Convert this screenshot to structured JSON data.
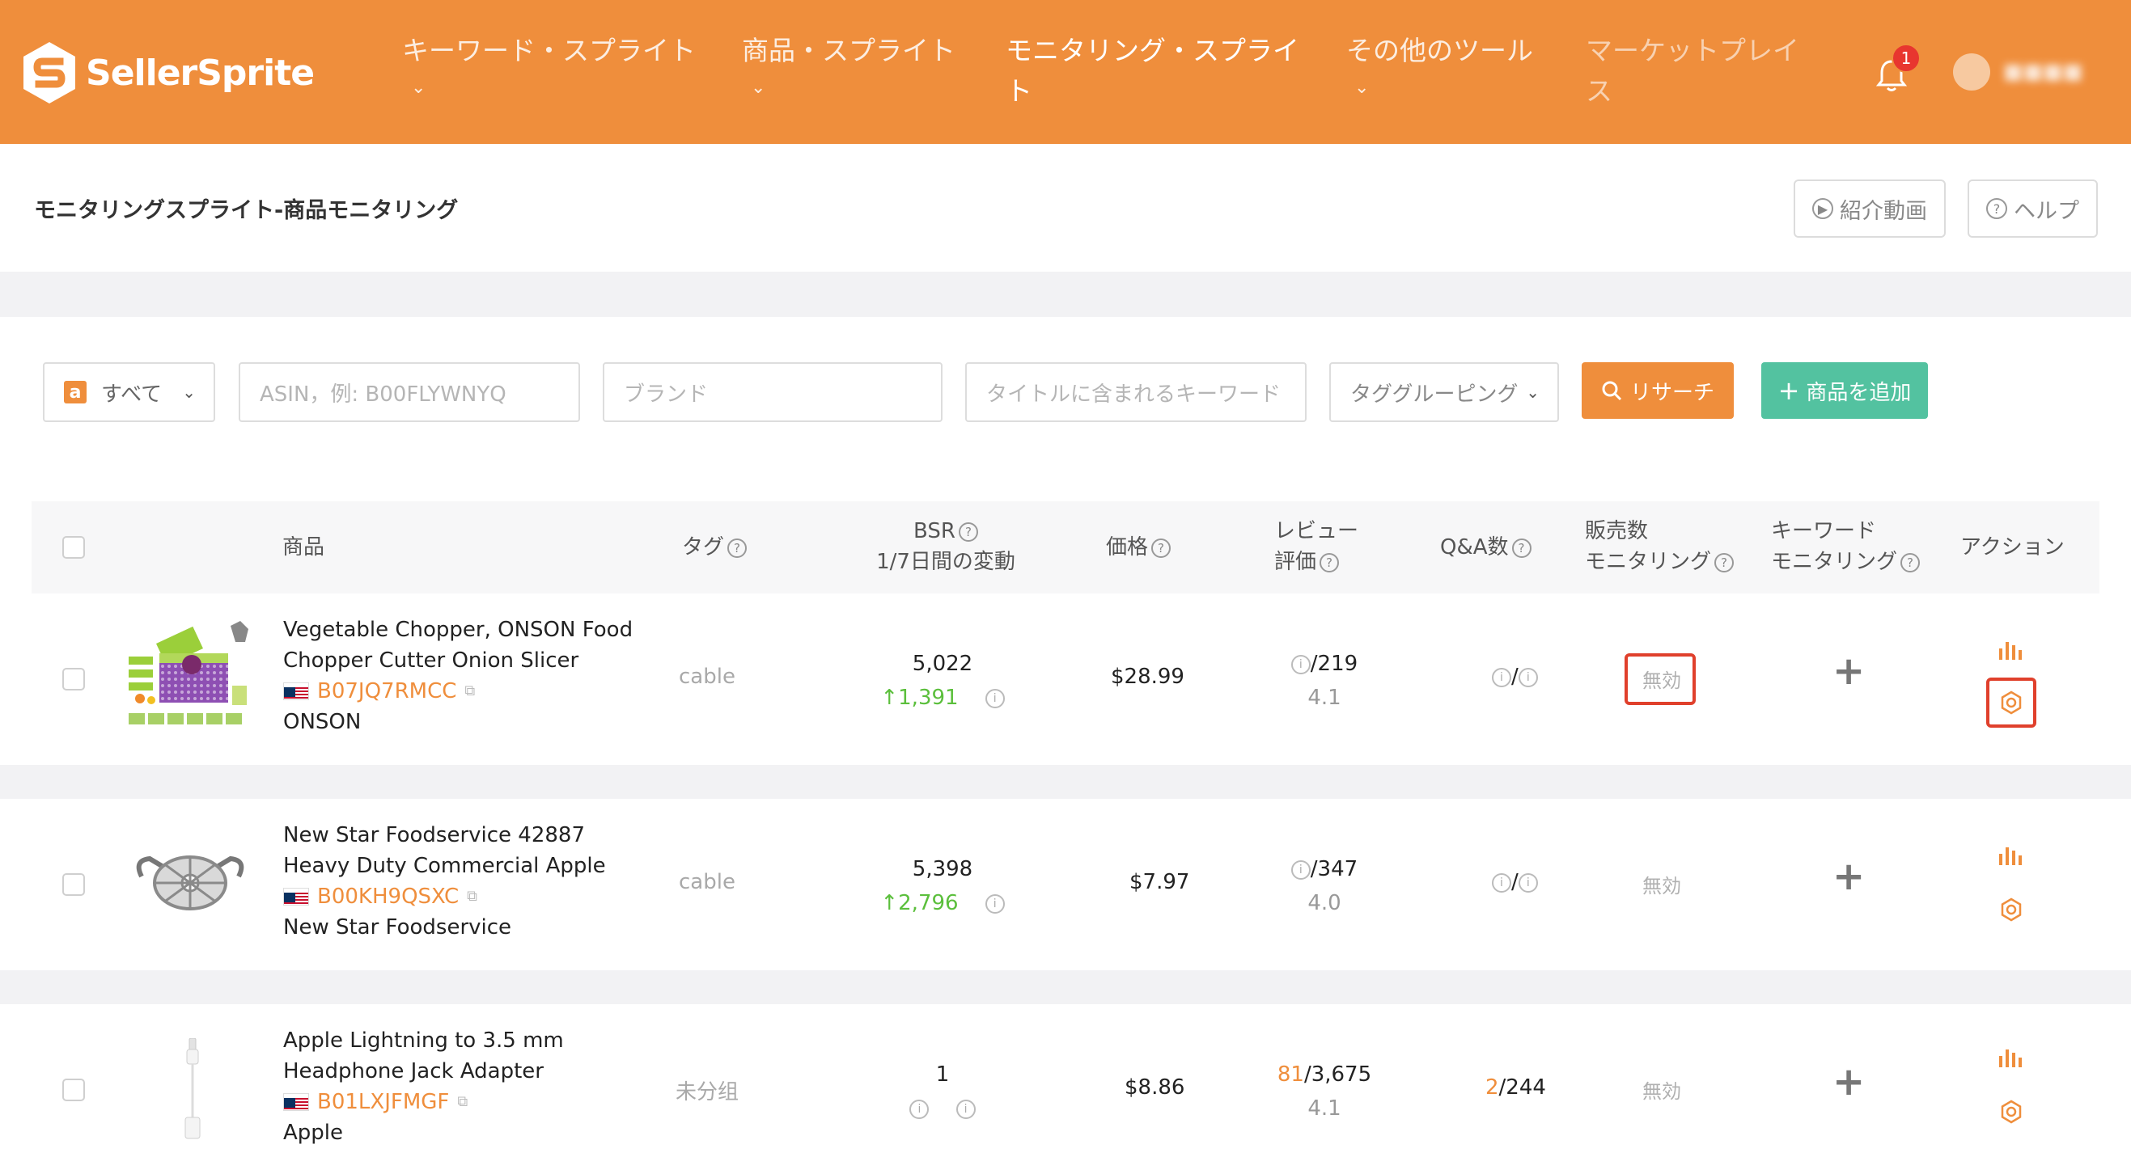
{
  "app": {
    "brand": "SellerSprite"
  },
  "nav": [
    {
      "label": "キーワード・スプライト"
    },
    {
      "label": "商品・スプライト"
    },
    {
      "label_line1": "モニタリング・スプライ",
      "label_line2": "ト"
    },
    {
      "label": "その他のツール"
    },
    {
      "label_line1": "マーケットプレイ",
      "label_line2": "ス"
    }
  ],
  "notifications": {
    "count": "1"
  },
  "page": {
    "title": "モニタリングスプライト-商品モニタリング",
    "video_button": "紹介動画",
    "help_button": "ヘルプ"
  },
  "filters": {
    "marketplace": "すべて",
    "asin_placeholder": "ASIN，例: B00FLYWNYQ",
    "brand_placeholder": "ブランド",
    "keyword_placeholder": "タイトルに含まれるキーワード",
    "tag_grouping": "タググルーピング",
    "search_button": "リサーチ",
    "add_button": "商品を追加"
  },
  "table": {
    "headers": {
      "product": "商品",
      "tag": "タグ",
      "bsr_line1": "BSR",
      "bsr_line2": "1/7日間の変動",
      "price": "価格",
      "review_line1": "レビュー",
      "review_line2": "評価",
      "qa": "Q&A数",
      "sales_line1": "販売数",
      "sales_line2": "モニタリング",
      "kw_line1": "キーワード",
      "kw_line2": "モニタリング",
      "action": "アクション"
    },
    "rows": [
      {
        "title_line1": "Vegetable Chopper, ONSON Food",
        "title_line2": "Chopper Cutter Onion Slicer",
        "asin": "B07JQ7RMCC",
        "brand": "ONSON",
        "tag": "cable",
        "bsr": "5,022",
        "bsr_change": "1,391",
        "price": "$28.99",
        "review_prefix": "",
        "review_total": "/219",
        "rating": "4.1",
        "qa_prefix": "",
        "qa_total": "/",
        "sales_status": "無効"
      },
      {
        "title_line1": "New Star Foodservice 42887",
        "title_line2": "Heavy Duty Commercial Apple",
        "asin": "B00KH9QSXC",
        "brand": "New Star Foodservice",
        "tag": "cable",
        "bsr": "5,398",
        "bsr_change": "2,796",
        "price": "$7.97",
        "review_prefix": "",
        "review_total": "/347",
        "rating": "4.0",
        "qa_prefix": "",
        "qa_total": "/",
        "sales_status": "無効"
      },
      {
        "title_line1": "Apple Lightning to 3.5 mm",
        "title_line2": "Headphone Jack Adapter",
        "asin": "B01LXJFMGF",
        "brand": "Apple",
        "tag": "未分组",
        "bsr": "1",
        "bsr_change": "",
        "price": "$8.86",
        "review_prefix": "81",
        "review_total": "/3,675",
        "rating": "4.1",
        "qa_prefix": "2",
        "qa_total": "/244",
        "sales_status": "無効"
      }
    ]
  },
  "colors": {
    "brand_orange": "#ef8e3c",
    "add_green": "#53c2a0",
    "change_green": "#5bbf3c",
    "highlight_red": "#e0402c"
  }
}
